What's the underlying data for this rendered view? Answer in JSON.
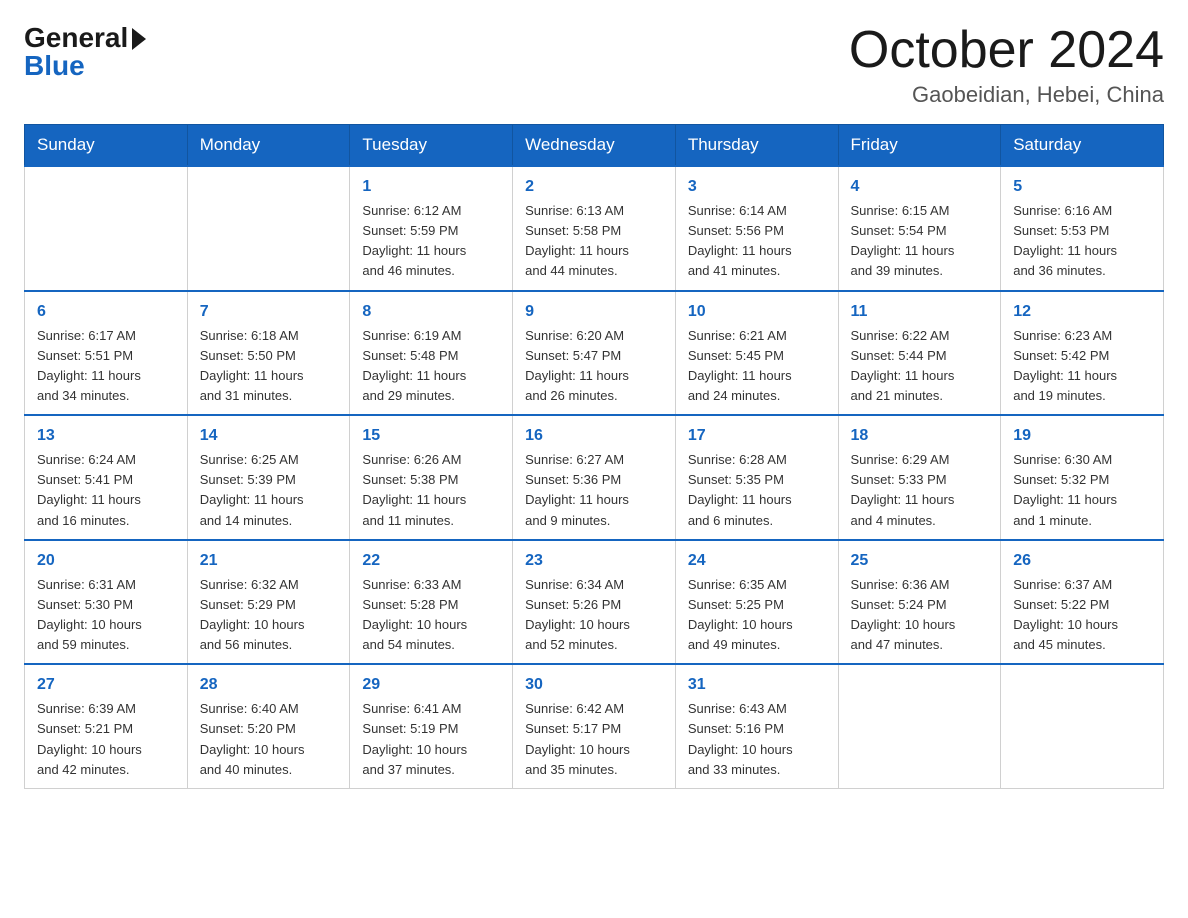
{
  "header": {
    "logo_general": "General",
    "logo_blue": "Blue",
    "month_year": "October 2024",
    "location": "Gaobeidian, Hebei, China"
  },
  "weekdays": [
    "Sunday",
    "Monday",
    "Tuesday",
    "Wednesday",
    "Thursday",
    "Friday",
    "Saturday"
  ],
  "weeks": [
    [
      {
        "day": "",
        "info": ""
      },
      {
        "day": "",
        "info": ""
      },
      {
        "day": "1",
        "info": "Sunrise: 6:12 AM\nSunset: 5:59 PM\nDaylight: 11 hours\nand 46 minutes."
      },
      {
        "day": "2",
        "info": "Sunrise: 6:13 AM\nSunset: 5:58 PM\nDaylight: 11 hours\nand 44 minutes."
      },
      {
        "day": "3",
        "info": "Sunrise: 6:14 AM\nSunset: 5:56 PM\nDaylight: 11 hours\nand 41 minutes."
      },
      {
        "day": "4",
        "info": "Sunrise: 6:15 AM\nSunset: 5:54 PM\nDaylight: 11 hours\nand 39 minutes."
      },
      {
        "day": "5",
        "info": "Sunrise: 6:16 AM\nSunset: 5:53 PM\nDaylight: 11 hours\nand 36 minutes."
      }
    ],
    [
      {
        "day": "6",
        "info": "Sunrise: 6:17 AM\nSunset: 5:51 PM\nDaylight: 11 hours\nand 34 minutes."
      },
      {
        "day": "7",
        "info": "Sunrise: 6:18 AM\nSunset: 5:50 PM\nDaylight: 11 hours\nand 31 minutes."
      },
      {
        "day": "8",
        "info": "Sunrise: 6:19 AM\nSunset: 5:48 PM\nDaylight: 11 hours\nand 29 minutes."
      },
      {
        "day": "9",
        "info": "Sunrise: 6:20 AM\nSunset: 5:47 PM\nDaylight: 11 hours\nand 26 minutes."
      },
      {
        "day": "10",
        "info": "Sunrise: 6:21 AM\nSunset: 5:45 PM\nDaylight: 11 hours\nand 24 minutes."
      },
      {
        "day": "11",
        "info": "Sunrise: 6:22 AM\nSunset: 5:44 PM\nDaylight: 11 hours\nand 21 minutes."
      },
      {
        "day": "12",
        "info": "Sunrise: 6:23 AM\nSunset: 5:42 PM\nDaylight: 11 hours\nand 19 minutes."
      }
    ],
    [
      {
        "day": "13",
        "info": "Sunrise: 6:24 AM\nSunset: 5:41 PM\nDaylight: 11 hours\nand 16 minutes."
      },
      {
        "day": "14",
        "info": "Sunrise: 6:25 AM\nSunset: 5:39 PM\nDaylight: 11 hours\nand 14 minutes."
      },
      {
        "day": "15",
        "info": "Sunrise: 6:26 AM\nSunset: 5:38 PM\nDaylight: 11 hours\nand 11 minutes."
      },
      {
        "day": "16",
        "info": "Sunrise: 6:27 AM\nSunset: 5:36 PM\nDaylight: 11 hours\nand 9 minutes."
      },
      {
        "day": "17",
        "info": "Sunrise: 6:28 AM\nSunset: 5:35 PM\nDaylight: 11 hours\nand 6 minutes."
      },
      {
        "day": "18",
        "info": "Sunrise: 6:29 AM\nSunset: 5:33 PM\nDaylight: 11 hours\nand 4 minutes."
      },
      {
        "day": "19",
        "info": "Sunrise: 6:30 AM\nSunset: 5:32 PM\nDaylight: 11 hours\nand 1 minute."
      }
    ],
    [
      {
        "day": "20",
        "info": "Sunrise: 6:31 AM\nSunset: 5:30 PM\nDaylight: 10 hours\nand 59 minutes."
      },
      {
        "day": "21",
        "info": "Sunrise: 6:32 AM\nSunset: 5:29 PM\nDaylight: 10 hours\nand 56 minutes."
      },
      {
        "day": "22",
        "info": "Sunrise: 6:33 AM\nSunset: 5:28 PM\nDaylight: 10 hours\nand 54 minutes."
      },
      {
        "day": "23",
        "info": "Sunrise: 6:34 AM\nSunset: 5:26 PM\nDaylight: 10 hours\nand 52 minutes."
      },
      {
        "day": "24",
        "info": "Sunrise: 6:35 AM\nSunset: 5:25 PM\nDaylight: 10 hours\nand 49 minutes."
      },
      {
        "day": "25",
        "info": "Sunrise: 6:36 AM\nSunset: 5:24 PM\nDaylight: 10 hours\nand 47 minutes."
      },
      {
        "day": "26",
        "info": "Sunrise: 6:37 AM\nSunset: 5:22 PM\nDaylight: 10 hours\nand 45 minutes."
      }
    ],
    [
      {
        "day": "27",
        "info": "Sunrise: 6:39 AM\nSunset: 5:21 PM\nDaylight: 10 hours\nand 42 minutes."
      },
      {
        "day": "28",
        "info": "Sunrise: 6:40 AM\nSunset: 5:20 PM\nDaylight: 10 hours\nand 40 minutes."
      },
      {
        "day": "29",
        "info": "Sunrise: 6:41 AM\nSunset: 5:19 PM\nDaylight: 10 hours\nand 37 minutes."
      },
      {
        "day": "30",
        "info": "Sunrise: 6:42 AM\nSunset: 5:17 PM\nDaylight: 10 hours\nand 35 minutes."
      },
      {
        "day": "31",
        "info": "Sunrise: 6:43 AM\nSunset: 5:16 PM\nDaylight: 10 hours\nand 33 minutes."
      },
      {
        "day": "",
        "info": ""
      },
      {
        "day": "",
        "info": ""
      }
    ]
  ]
}
